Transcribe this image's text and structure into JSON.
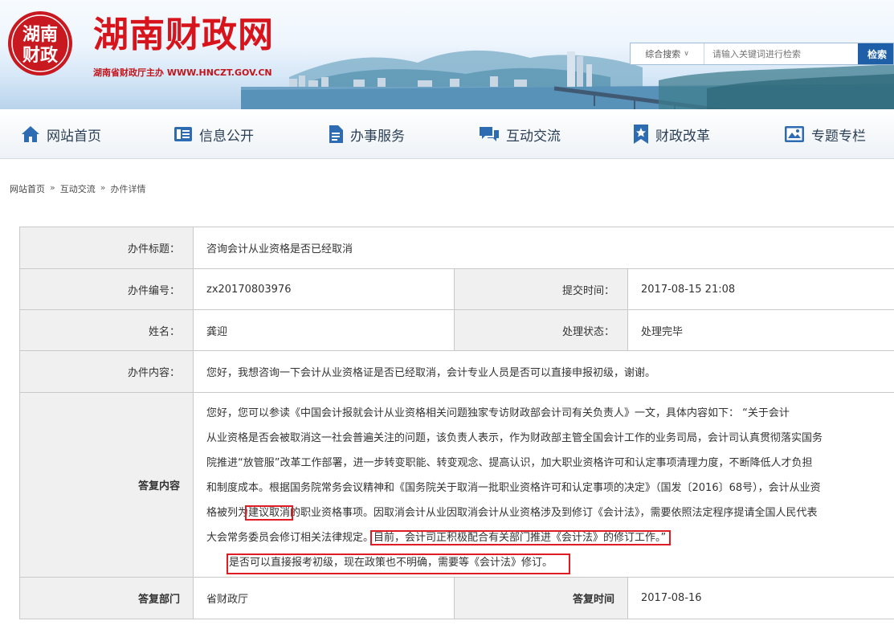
{
  "header": {
    "seal_text": "湖南财政",
    "site_title": "湖南财政网",
    "site_subtitle": "湖南省财政厅主办 WWW.HNCZT.GOV.CN",
    "search": {
      "scope_label": "综合搜索",
      "placeholder": "请输入关键词进行检索",
      "button_label": "检索"
    }
  },
  "nav": {
    "items": [
      {
        "label": "网站首页",
        "icon": "home-icon"
      },
      {
        "label": "信息公开",
        "icon": "info-list-icon"
      },
      {
        "label": "办事服务",
        "icon": "document-icon"
      },
      {
        "label": "互动交流",
        "icon": "chat-icon"
      },
      {
        "label": "财政改革",
        "icon": "star-bookmark-icon"
      },
      {
        "label": "专题专栏",
        "icon": "picture-icon"
      }
    ]
  },
  "breadcrumb": {
    "items": [
      "网站首页",
      "互动交流",
      "办件详情"
    ],
    "separator": "»"
  },
  "detail": {
    "title_label": "办件标题：",
    "title_value": "咨询会计从业资格是否已经取消",
    "number_label": "办件编号：",
    "number_value": "zx20170803976",
    "submit_time_label": "提交时间：",
    "submit_time_value": "2017-08-15 21:08",
    "name_label": "姓名：",
    "name_value": "龚迎",
    "status_label": "处理状态：",
    "status_value": "处理完毕",
    "content_label": "办件内容：",
    "content_value": "您好，我想咨询一下会计从业资格证是否已经取消，会计专业人员是否可以直接申报初级，谢谢。",
    "reply_label": "答复内容",
    "reply_lines": [
      "您好，您可以参读《中国会计报就会计从业资格相关问题独家专访财政部会计司有关负责人》一文，具体内容如下：        “关于会计",
      "从业资格是否会被取消这一社会普遍关注的问题，该负责人表示，作为财政部主管全国会计工作的业务司局，会计司认真贯彻落实国务",
      "院推进“放管服”改革工作部署，进一步转变职能、转变观念、提高认识，加大职业资格许可和认定事项清理力度，不断降低人才负担",
      "和制度成本。根据国务院常务会议精神和《国务院关于取消一批职业资格许可和认定事项的决定》（国发〔2016〕68号），会计从业资"
    ],
    "reply_line5_pre": "格被列为",
    "reply_line5_hl": "建议取消",
    "reply_line5_post": "的职业资格事项。因取消会计从业因取消会计从业资格涉及到修订《会计法》，需要依照法定程序提请全国人民代表",
    "reply_line6_pre": "大会常务委员会修订相关法律规定。",
    "reply_line6_hl": "目前，会计司正积极配合有关部门推进《会计法》的修订工作。”",
    "reply_line7": "是否可以直接报考初级，现在政策也不明确，需要等《会计法》修订。",
    "dept_label": "答复部门",
    "dept_value": "省财政厅",
    "reply_time_label": "答复时间",
    "reply_time_value": "2017-08-16"
  },
  "colors": {
    "brand_red": "#d7141b",
    "highlight_box": "#e01b24",
    "search_button": "#1e5fa8",
    "label_bg": "#f0f0f0"
  }
}
